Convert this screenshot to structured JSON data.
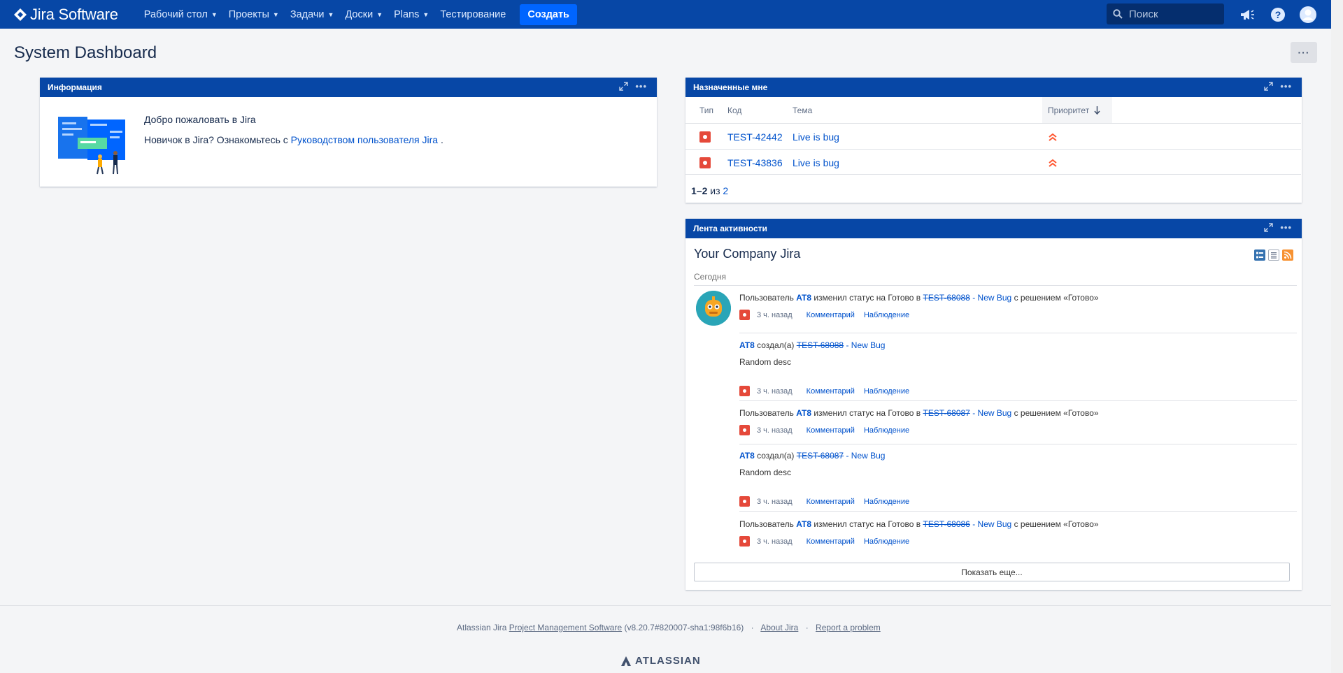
{
  "header": {
    "logo_text": "Jira Software",
    "menu": [
      {
        "label": "Рабочий стол"
      },
      {
        "label": "Проекты"
      },
      {
        "label": "Задачи"
      },
      {
        "label": "Доски"
      },
      {
        "label": "Plans"
      },
      {
        "label": "Тестирование"
      }
    ],
    "create_label": "Создать",
    "search_placeholder": "Поиск"
  },
  "page": {
    "title": "System Dashboard",
    "more_label": "···"
  },
  "info_gadget": {
    "title": "Информация",
    "welcome": "Добро пожаловать в Jira",
    "newbie_prefix": "Новичок в Jira? Ознакомьтесь с",
    "guide_link": "Руководством пользователя Jira",
    "newbie_suffix": "."
  },
  "assigned_gadget": {
    "title": "Назначенные мне",
    "columns": {
      "type": "Тип",
      "key": "Код",
      "summary": "Тема",
      "priority": "Приоритет"
    },
    "rows": [
      {
        "key": "TEST-42442",
        "summary": "Live is bug"
      },
      {
        "key": "TEST-43836",
        "summary": "Live is bug"
      }
    ],
    "pager_range": "1–2",
    "pager_of": "из",
    "pager_total": "2"
  },
  "activity_gadget": {
    "title": "Лента активности",
    "stream_title": "Your Company Jira",
    "today": "Сегодня",
    "entries": [
      {
        "pre": "Пользователь",
        "user": "AT8",
        "mid": "изменил статус на Готово в",
        "issue": "TEST-68088",
        "dash": " - ",
        "summary": "New Bug",
        "post": "с решением «Готово»",
        "time": "3 ч. назад",
        "comment": "Комментарий",
        "watch": "Наблюдение"
      },
      {
        "user": "AT8",
        "mid": "создал(а)",
        "issue": "TEST-68088",
        "dash": " - ",
        "summary": "New Bug",
        "desc": "Random desc",
        "time": "3 ч. назад",
        "comment": "Комментарий",
        "watch": "Наблюдение"
      },
      {
        "pre": "Пользователь",
        "user": "AT8",
        "mid": "изменил статус на Готово в",
        "issue": "TEST-68087",
        "dash": " - ",
        "summary": "New Bug",
        "post": "с решением «Готово»",
        "time": "3 ч. назад",
        "comment": "Комментарий",
        "watch": "Наблюдение"
      },
      {
        "user": "AT8",
        "mid": "создал(а)",
        "issue": "TEST-68087",
        "dash": " - ",
        "summary": "New Bug",
        "desc": "Random desc",
        "time": "3 ч. назад",
        "comment": "Комментарий",
        "watch": "Наблюдение"
      },
      {
        "pre": "Пользователь",
        "user": "AT8",
        "mid": "изменил статус на Готово в",
        "issue": "TEST-68086",
        "dash": " - ",
        "summary": "New Bug",
        "post": "с решением «Готово»",
        "time": "3 ч. назад",
        "comment": "Комментарий",
        "watch": "Наблюдение"
      }
    ],
    "show_more": "Показать еще..."
  },
  "footer": {
    "prefix": "Atlassian Jira",
    "pms_link": "Project Management Software",
    "version": "(v8.20.7#820007-sha1:98f6b16)",
    "sep": "·",
    "about": "About Jira",
    "report": "Report a problem",
    "brand": "ATLASSIAN"
  },
  "colors": {
    "header_bg": "#0747a6",
    "create_btn": "#0065ff",
    "link": "#0052cc",
    "bug": "#e5493a",
    "priority_highest": "#ff5630"
  }
}
